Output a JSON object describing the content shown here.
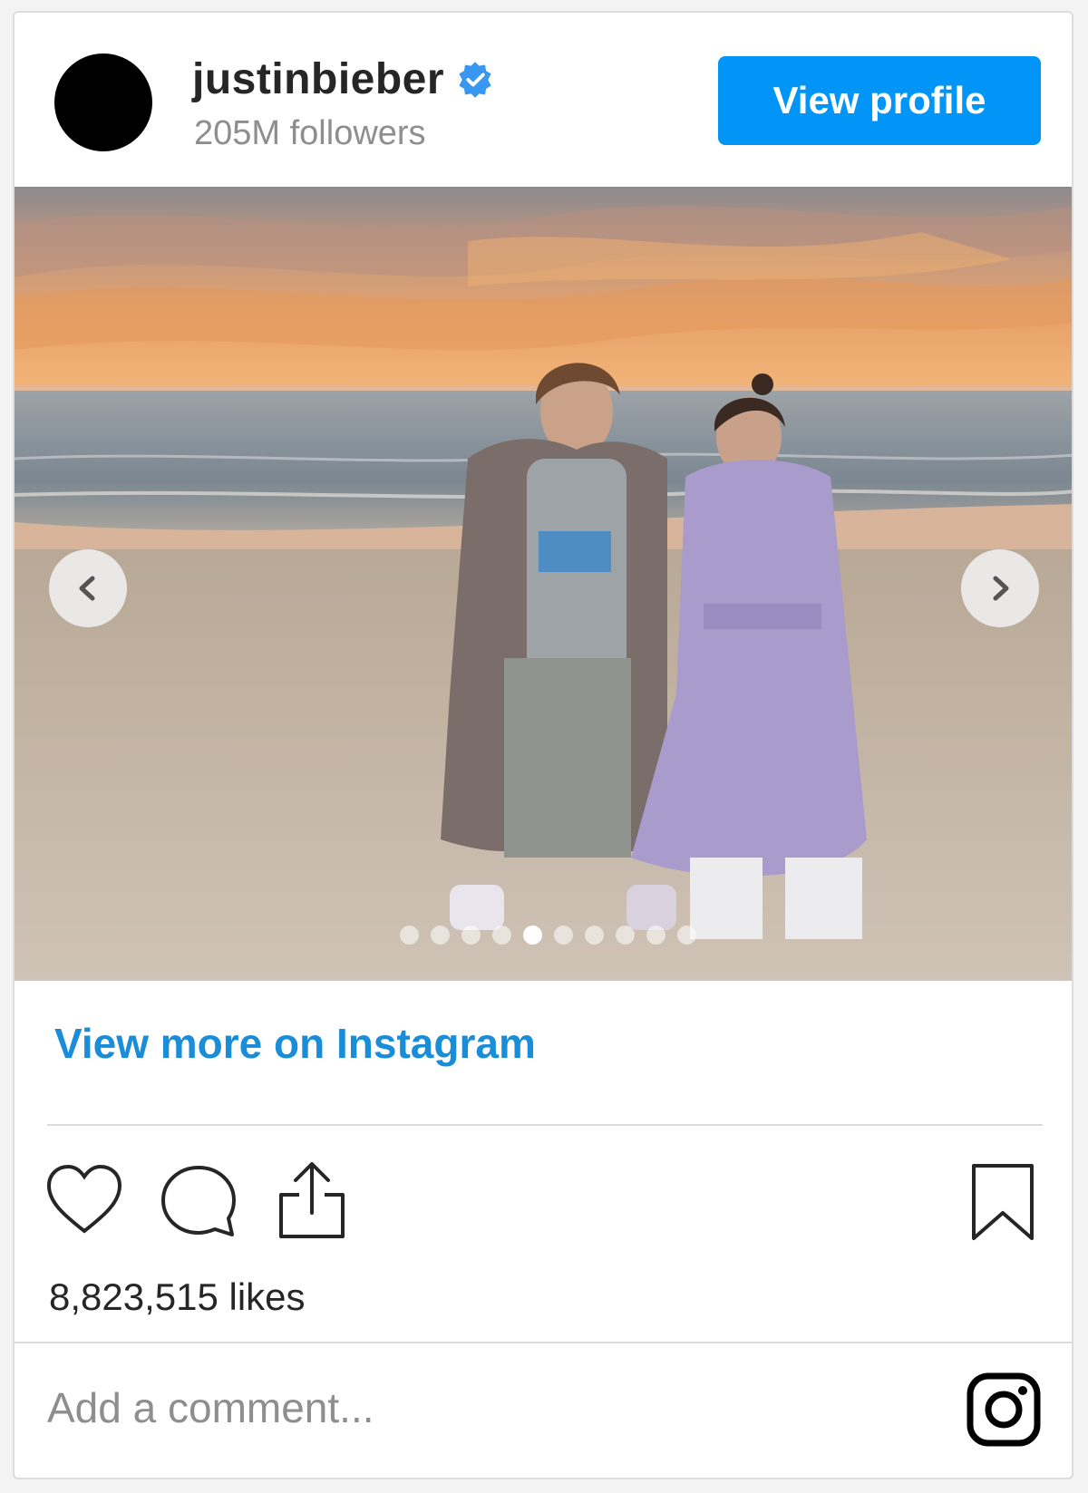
{
  "header": {
    "username": "justinbieber",
    "followers": "205M followers",
    "verified_icon": "verified-badge-icon",
    "view_profile_label": "View profile",
    "accent_color": "#0095f6"
  },
  "photo": {
    "icon_prev": "chevron-left-icon",
    "icon_next": "chevron-right-icon",
    "carousel_total": 10,
    "carousel_active_index": 4
  },
  "links": {
    "view_more": "View more on Instagram"
  },
  "actions": {
    "like_icon": "heart-icon",
    "comment_icon": "comment-icon",
    "share_icon": "share-icon",
    "save_icon": "bookmark-icon"
  },
  "likes": "8,823,515 likes",
  "comment": {
    "placeholder": "Add a comment...",
    "logo_icon": "instagram-logo-icon"
  }
}
